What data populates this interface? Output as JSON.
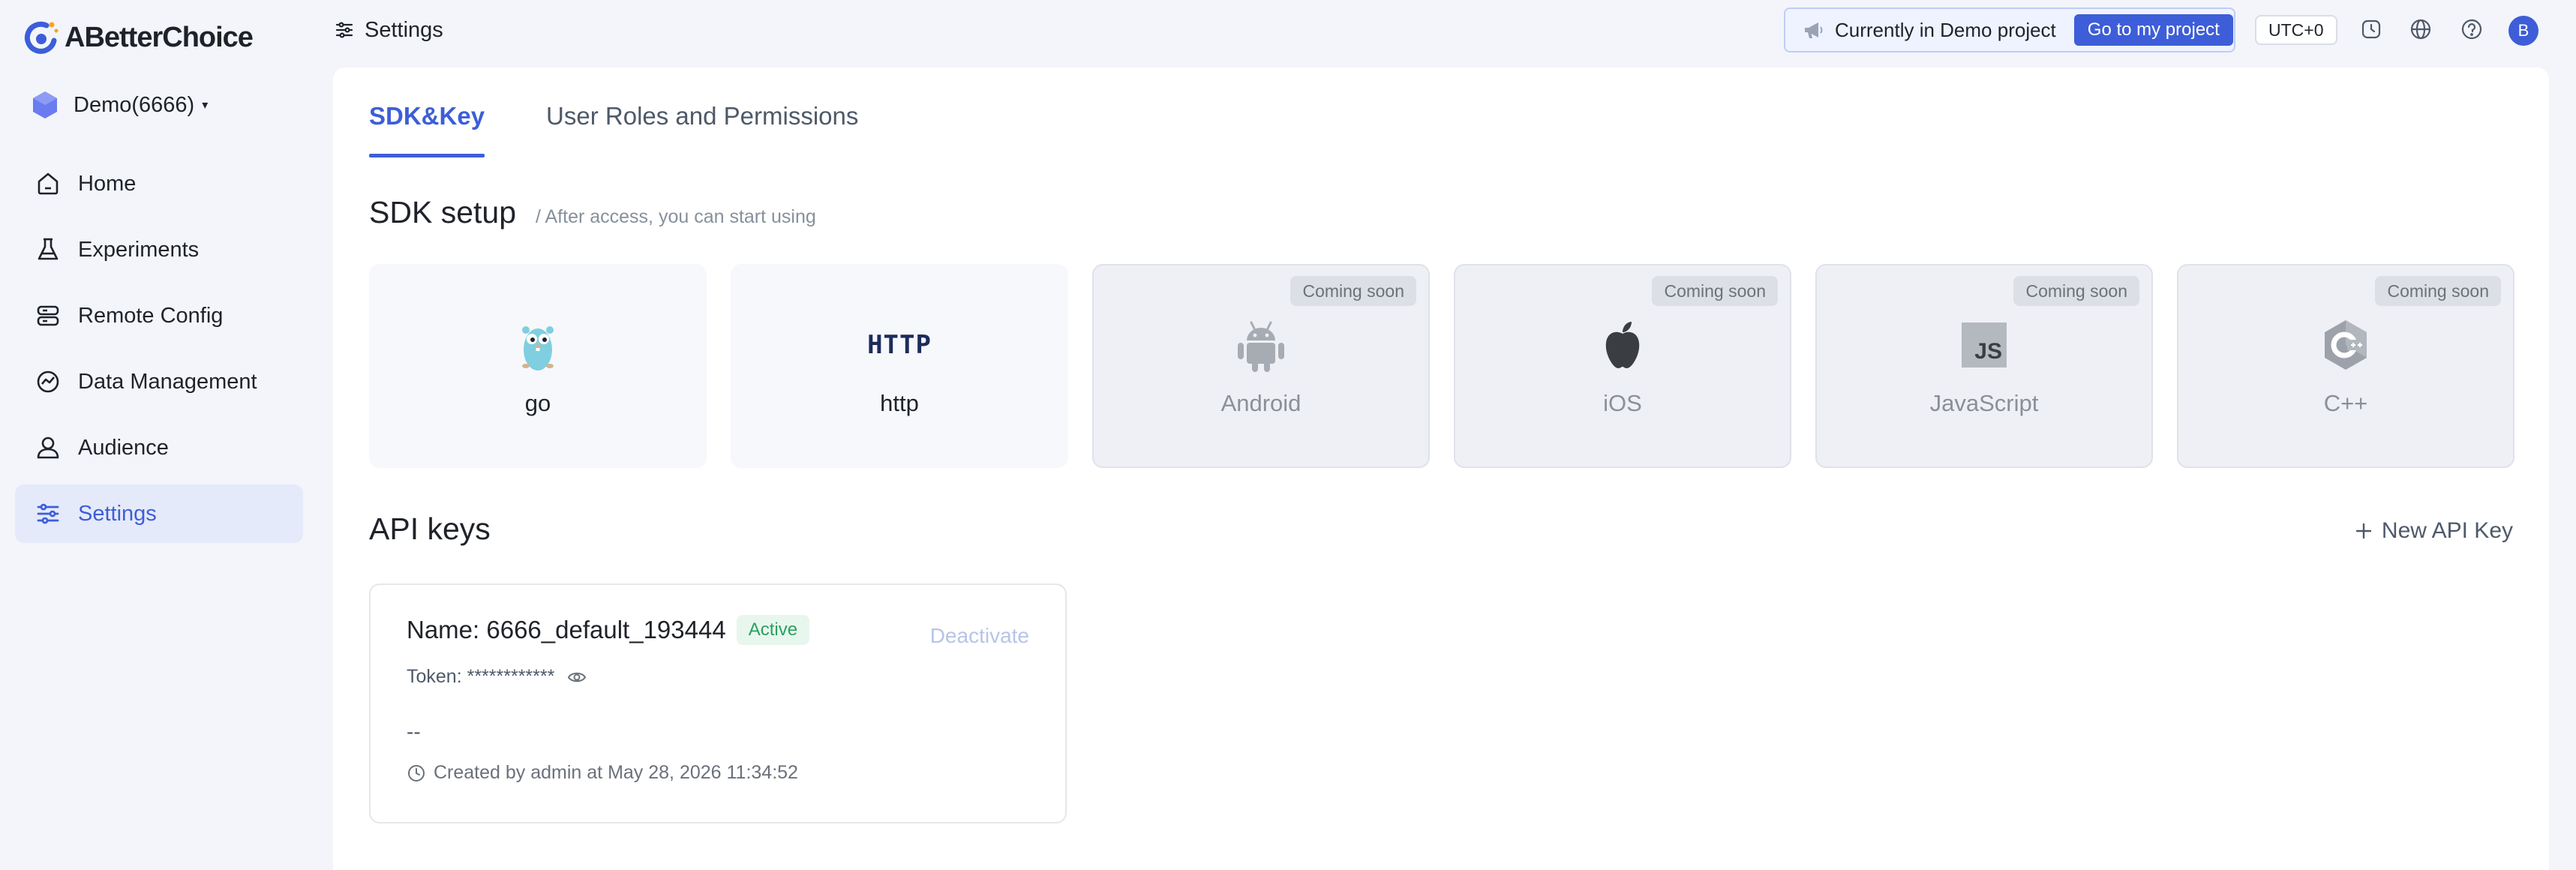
{
  "app": {
    "logo_text": "ABetterChoice"
  },
  "project": {
    "name": "Demo(6666)"
  },
  "sidebar": {
    "items": [
      {
        "label": "Home",
        "icon": "home-icon"
      },
      {
        "label": "Experiments",
        "icon": "flask-icon"
      },
      {
        "label": "Remote Config",
        "icon": "server-icon"
      },
      {
        "label": "Data Management",
        "icon": "chart-circle-icon"
      },
      {
        "label": "Audience",
        "icon": "user-icon"
      },
      {
        "label": "Settings",
        "icon": "sliders-icon",
        "active": true
      }
    ]
  },
  "topbar": {
    "title": "Settings",
    "demo_text": "Currently in Demo project",
    "goto_label": "Go to my project",
    "timezone": "UTC+0",
    "avatar_initial": "B"
  },
  "tabs": [
    {
      "label": "SDK&Key",
      "active": true
    },
    {
      "label": "User Roles and Permissions",
      "active": false
    }
  ],
  "sdk": {
    "title": "SDK setup",
    "subtitle": "/ After access, you can start using",
    "cards": [
      {
        "label": "go",
        "icon": "gopher-icon",
        "available": true
      },
      {
        "label": "http",
        "icon": "http-icon",
        "icon_text": "HTTP",
        "available": true
      },
      {
        "label": "Android",
        "icon": "android-icon",
        "available": false,
        "badge": "Coming soon"
      },
      {
        "label": "iOS",
        "icon": "apple-icon",
        "available": false,
        "badge": "Coming soon"
      },
      {
        "label": "JavaScript",
        "icon": "javascript-icon",
        "icon_text": "JS",
        "available": false,
        "badge": "Coming soon"
      },
      {
        "label": "C++",
        "icon": "cpp-icon",
        "available": false,
        "badge": "Coming soon"
      }
    ]
  },
  "api": {
    "title": "API keys",
    "new_key_label": "New API Key",
    "keys": [
      {
        "name": "Name: 6666_default_193444",
        "status": "Active",
        "deactivate_label": "Deactivate",
        "token": "Token: ************",
        "description": "--",
        "created": "Created by admin at May 28, 2026 11:34:52"
      }
    ]
  },
  "colors": {
    "accent": "#3d5ed8",
    "active_green": "#2aa160",
    "background": "#f3f5fa"
  }
}
